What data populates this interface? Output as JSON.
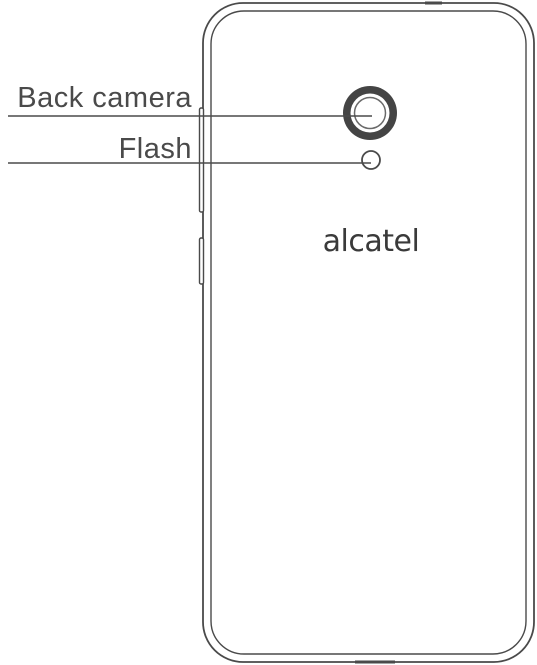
{
  "labels": {
    "back_camera": "Back camera",
    "flash": "Flash"
  },
  "brand": {
    "logo_text": "alcatel"
  },
  "colors": {
    "outline": "#4a4a4a",
    "lens_ring": "#444444",
    "background": "#ffffff"
  }
}
